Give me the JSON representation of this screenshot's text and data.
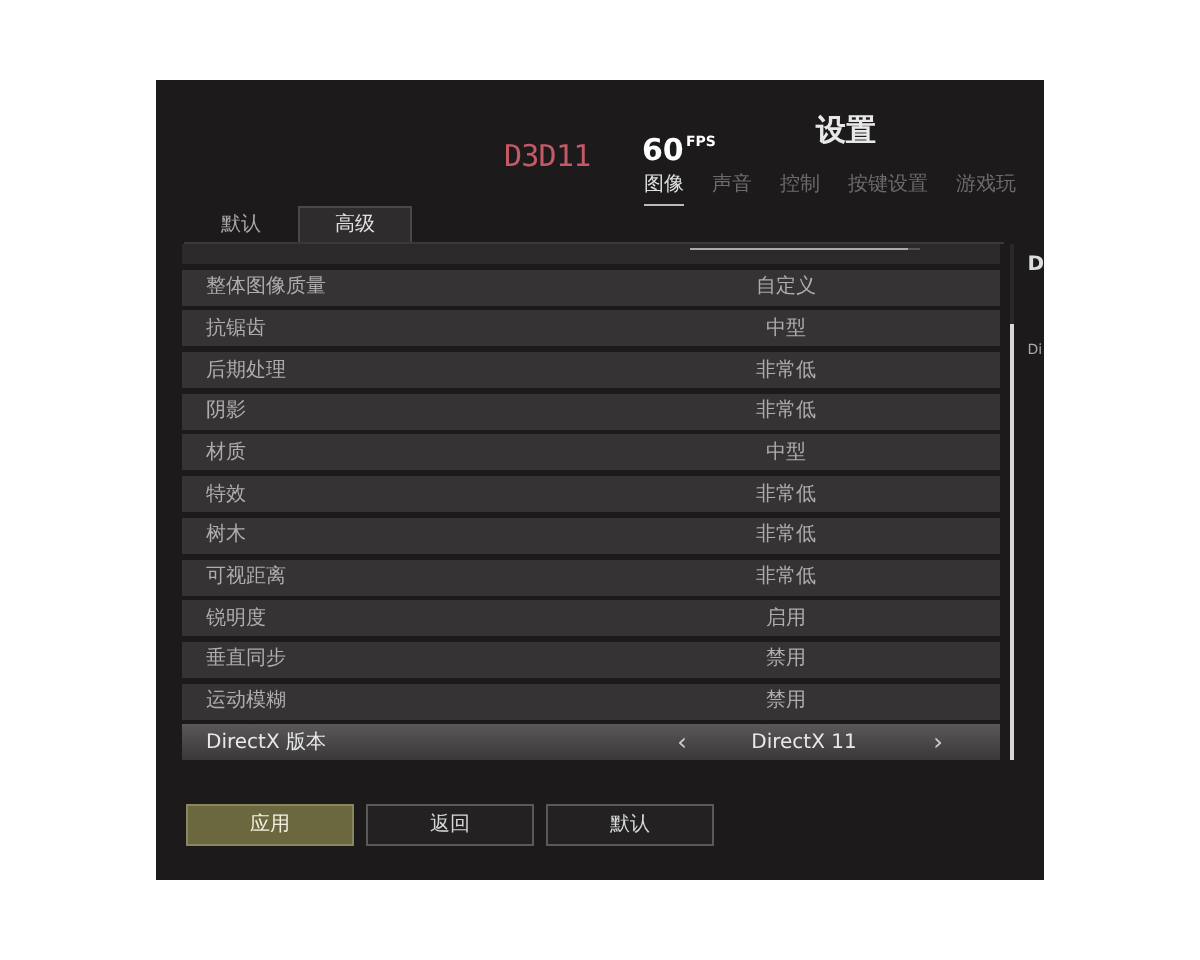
{
  "title": "设置",
  "renderer": "D3D11",
  "fps": {
    "value": "60",
    "unit": "FPS"
  },
  "tabs": [
    {
      "label": "图像",
      "selected": true
    },
    {
      "label": "声音",
      "selected": false
    },
    {
      "label": "控制",
      "selected": false
    },
    {
      "label": "按键设置",
      "selected": false
    },
    {
      "label": "游戏玩",
      "selected": false
    }
  ],
  "subtabs": [
    {
      "label": "默认",
      "selected": false
    },
    {
      "label": "高级",
      "selected": true
    }
  ],
  "top_slider": {
    "level": 0.95
  },
  "settings": [
    {
      "kind": "option",
      "label": "整体图像质量",
      "value": "自定义",
      "selected": false
    },
    {
      "kind": "option",
      "label": "抗锯齿",
      "value": "中型",
      "selected": false
    },
    {
      "kind": "option",
      "label": "后期处理",
      "value": "非常低",
      "selected": false
    },
    {
      "kind": "option",
      "label": "阴影",
      "value": "非常低",
      "selected": false
    },
    {
      "kind": "option",
      "label": "材质",
      "value": "中型",
      "selected": false
    },
    {
      "kind": "option",
      "label": "特效",
      "value": "非常低",
      "selected": false
    },
    {
      "kind": "option",
      "label": "树木",
      "value": "非常低",
      "selected": false
    },
    {
      "kind": "option",
      "label": "可视距离",
      "value": "非常低",
      "selected": false
    },
    {
      "kind": "option",
      "label": "锐明度",
      "value": "启用",
      "selected": false
    },
    {
      "kind": "option",
      "label": "垂直同步",
      "value": "禁用",
      "selected": false
    },
    {
      "kind": "option",
      "label": "运动模糊",
      "value": "禁用",
      "selected": false
    },
    {
      "kind": "selector",
      "label": "DirectX 版本",
      "value": "DirectX 11",
      "prev": "‹",
      "next": "›",
      "selected": true
    }
  ],
  "side_panel": {
    "heading": "D",
    "text": "Di"
  },
  "buttons": [
    {
      "label": "应用",
      "primary": true
    },
    {
      "label": "返回",
      "primary": false
    },
    {
      "label": "默认",
      "primary": false
    }
  ]
}
